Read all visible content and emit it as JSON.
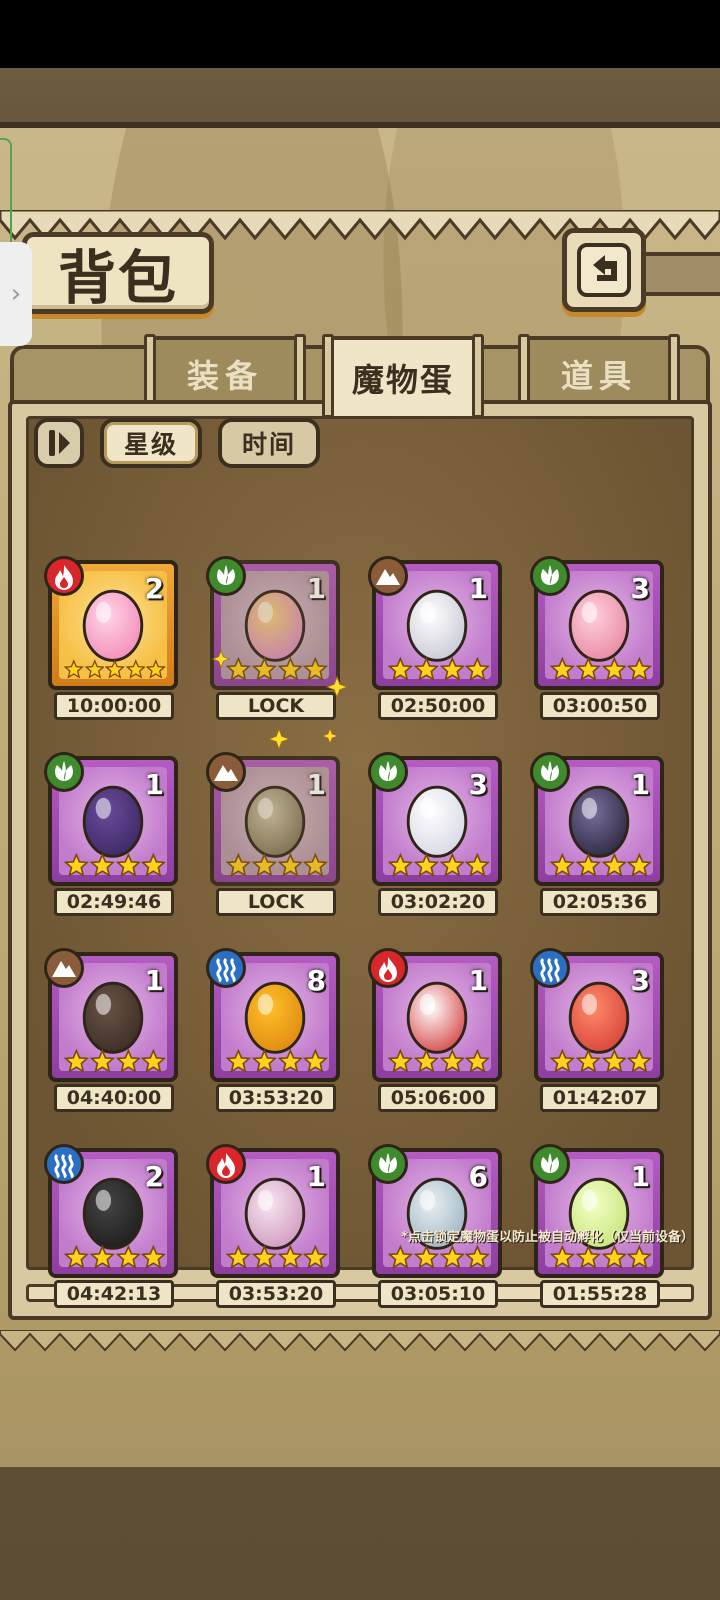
{
  "header": {
    "title": "背包"
  },
  "tabs": [
    {
      "label": "装备",
      "active": false
    },
    {
      "label": "魔物蛋",
      "active": true
    },
    {
      "label": "道具",
      "active": false
    }
  ],
  "sort": {
    "toggle_icon": "sort-toggle-icon",
    "star_label": "星级",
    "time_label": "时间"
  },
  "eggs": [
    {
      "element": "fire",
      "count": "2",
      "stars": 5,
      "timer": "10:00:00",
      "frame": "gold",
      "art": "pink-bow-egg"
    },
    {
      "element": "leaf",
      "count": "1",
      "stars": 4,
      "timer": "LOCK",
      "frame": "locked",
      "art": "rainbow-egg"
    },
    {
      "element": "earth",
      "count": "1",
      "stars": 4,
      "timer": "02:50:00",
      "frame": "purple",
      "art": "wrapped-egg"
    },
    {
      "element": "leaf",
      "count": "3",
      "stars": 4,
      "timer": "03:00:50",
      "frame": "purple",
      "art": "pink-fluffy-egg"
    },
    {
      "element": "leaf",
      "count": "1",
      "stars": 4,
      "timer": "02:49:46",
      "frame": "purple",
      "art": "winged-purple-egg"
    },
    {
      "element": "earth",
      "count": "1",
      "stars": 4,
      "timer": "LOCK",
      "frame": "locked",
      "art": "striped-egg"
    },
    {
      "element": "leaf",
      "count": "3",
      "stars": 4,
      "timer": "03:02:20",
      "frame": "purple",
      "art": "ring-egg"
    },
    {
      "element": "leaf",
      "count": "1",
      "stars": 4,
      "timer": "02:05:36",
      "frame": "purple",
      "art": "studded-egg"
    },
    {
      "element": "earth",
      "count": "1",
      "stars": 4,
      "timer": "04:40:00",
      "frame": "purple",
      "art": "mouse-egg"
    },
    {
      "element": "water",
      "count": "8",
      "stars": 4,
      "timer": "03:53:20",
      "frame": "purple",
      "art": "pudding-egg"
    },
    {
      "element": "fire",
      "count": "1",
      "stars": 4,
      "timer": "05:06:00",
      "frame": "purple",
      "art": "tied-red-egg"
    },
    {
      "element": "water",
      "count": "3",
      "stars": 4,
      "timer": "01:42:07",
      "frame": "purple",
      "art": "feather-egg"
    },
    {
      "element": "water",
      "count": "2",
      "stars": 4,
      "timer": "04:42:13",
      "frame": "purple",
      "art": "spiky-dark-egg"
    },
    {
      "element": "fire",
      "count": "1",
      "stars": 4,
      "timer": "03:53:20",
      "frame": "purple",
      "art": "bat-egg"
    },
    {
      "element": "leaf",
      "count": "6",
      "stars": 4,
      "timer": "03:05:10",
      "frame": "purple",
      "art": "tusk-egg"
    },
    {
      "element": "leaf",
      "count": "1",
      "stars": 4,
      "timer": "01:55:28",
      "frame": "purple",
      "art": "leaf-green-egg"
    }
  ],
  "footnote": "*点击锁定魔物蛋以防止被自动孵化（仅当前设备）",
  "colors": {
    "fire": "#d8262a",
    "leaf": "#3e8a2c",
    "earth": "#8b5c3a",
    "water": "#2b6fc4",
    "card_purple": "#b45cc2",
    "card_gold": "#f0a83a",
    "star": "#ffd21e"
  }
}
